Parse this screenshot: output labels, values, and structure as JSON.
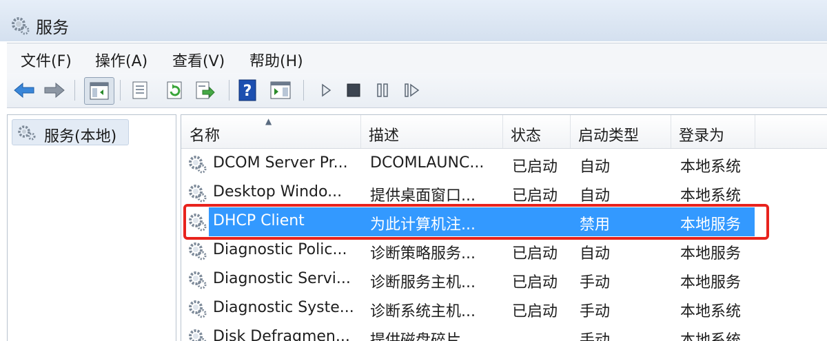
{
  "window": {
    "title": "服务",
    "icon": "services-gear-icon"
  },
  "menu": [
    {
      "label": "文件(F)"
    },
    {
      "label": "操作(A)"
    },
    {
      "label": "查看(V)"
    },
    {
      "label": "帮助(H)"
    }
  ],
  "toolbar": {
    "buttons": [
      "back-arrow-icon",
      "forward-arrow-icon",
      "show-hide-console-tree-icon",
      "properties-icon",
      "refresh-icon",
      "export-list-icon",
      "help-icon",
      "show-action-pane-icon",
      "start-service-icon",
      "stop-service-icon",
      "pause-service-icon",
      "restart-service-icon"
    ],
    "colors": {
      "arrow": "#3a86d8",
      "refresh": "#3aa53a",
      "help": "#1c4fb0"
    }
  },
  "tree": {
    "label": "服务(本地)"
  },
  "columns": {
    "name": "名称",
    "desc": "描述",
    "status": "状态",
    "startup": "启动类型",
    "logon": "登录为"
  },
  "rows": [
    {
      "name": "DCOM Server Pr...",
      "desc": "DCOMLAUNC...",
      "status": "已启动",
      "startup": "自动",
      "logon": "本地系统"
    },
    {
      "name": "Desktop Windo...",
      "desc": "提供桌面窗口...",
      "status": "已启动",
      "startup": "自动",
      "logon": "本地系统"
    },
    {
      "name": "DHCP Client",
      "desc": "为此计算机注...",
      "status": "",
      "startup": "禁用",
      "logon": "本地服务"
    },
    {
      "name": "Diagnostic Polic...",
      "desc": "诊断策略服务...",
      "status": "已启动",
      "startup": "自动",
      "logon": "本地服务"
    },
    {
      "name": "Diagnostic Servi...",
      "desc": "诊断服务主机...",
      "status": "已启动",
      "startup": "手动",
      "logon": "本地服务"
    },
    {
      "name": "Diagnostic Syste...",
      "desc": "诊断系统主机...",
      "status": "已启动",
      "startup": "手动",
      "logon": "本地系统"
    },
    {
      "name": "Disk Defragmen...",
      "desc": "提供磁盘碎片...",
      "status": "",
      "startup": "手动",
      "logon": "本地系统"
    }
  ],
  "selection": {
    "color": "#3399ff",
    "highlight_border": "#e8231d"
  }
}
